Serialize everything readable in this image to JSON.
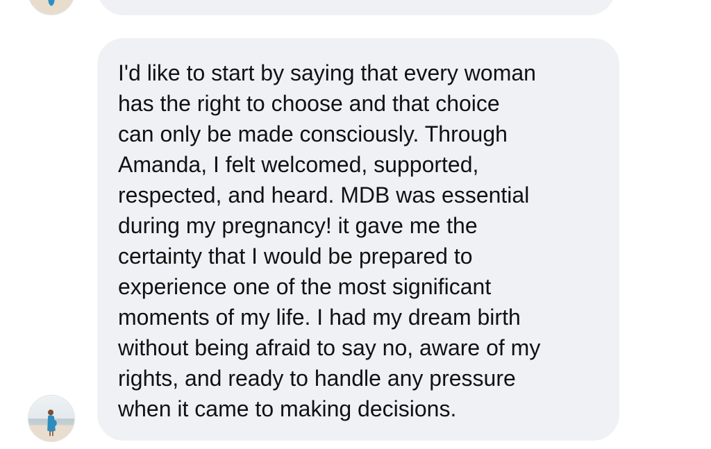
{
  "conversation": {
    "previous_message": {
      "sender": "contact",
      "avatar_icon": "user-avatar-icon"
    },
    "current_message": {
      "sender": "contact",
      "avatar_icon": "user-avatar-icon",
      "lines": [
        "I'd like to start by saying that every woman",
        "has the right to choose and that choice",
        "can only be made consciously. Through",
        "Amanda, I felt welcomed, supported,",
        "respected, and heard. MDB was essential",
        "during my pregnancy! it gave me the",
        "certainty that I would be prepared to",
        "experience one of the most significant",
        "moments of my life. I had my dream birth",
        "without being afraid to say no, aware of my",
        "rights, and ready to handle any pressure",
        "when it came to making decisions."
      ]
    }
  },
  "colors": {
    "bubble_background": "#f0f1f5",
    "text": "#111111",
    "page_background": "#ffffff"
  }
}
